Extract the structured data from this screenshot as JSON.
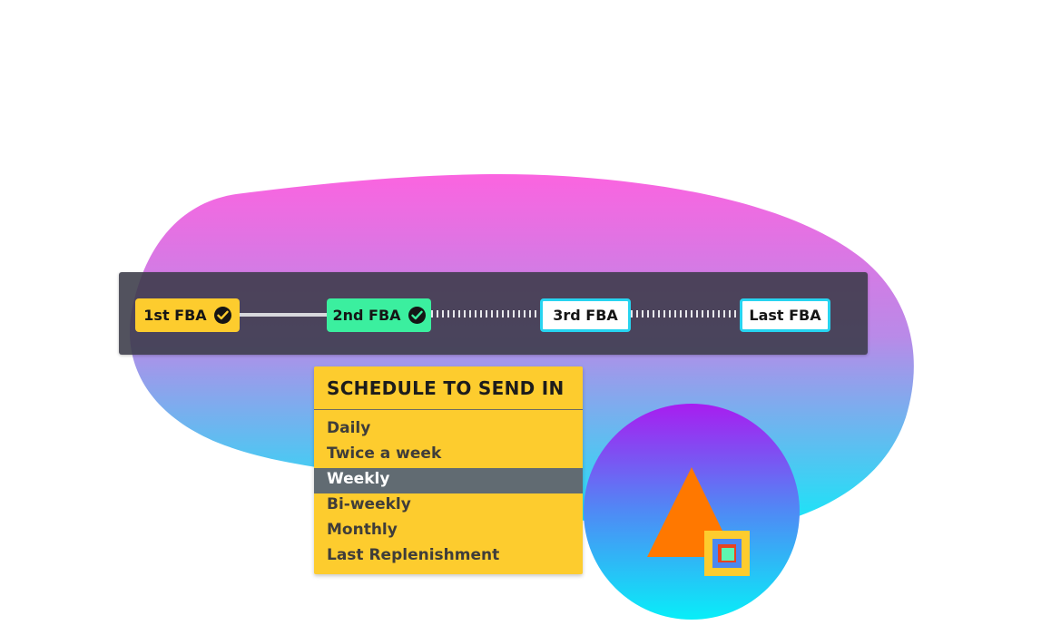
{
  "timeline": {
    "steps": [
      {
        "label": "1st FBA",
        "status": "completed",
        "color": "#fdcc2e",
        "icon": "checkmark-icon"
      },
      {
        "label": "2nd FBA",
        "status": "completed",
        "color": "#3bef9f",
        "icon": "checkmark-icon"
      },
      {
        "label": "3rd FBA",
        "status": "pending",
        "color": "#ffffff"
      },
      {
        "label": "Last FBA",
        "status": "pending",
        "color": "#ffffff"
      }
    ]
  },
  "schedule_menu": {
    "title": "SCHEDULE TO SEND IN",
    "items": [
      {
        "label": "Daily"
      },
      {
        "label": "Twice a week"
      },
      {
        "label": "Weekly"
      },
      {
        "label": "Bi-weekly"
      },
      {
        "label": "Monthly"
      },
      {
        "label": "Last Replenishment"
      }
    ],
    "selected": "Weekly",
    "colors": {
      "background": "#fdcc2e",
      "selected_background": "#616b72"
    }
  },
  "logo": {
    "icon": "triangle-square-logo",
    "colors": {
      "triangle": "#ff7800",
      "square_outer": "#fdcc2e",
      "square_inner": "#5ef5b0"
    }
  },
  "background": {
    "gradient_top": "#fb64e0",
    "gradient_bottom": "#18ecf8"
  }
}
